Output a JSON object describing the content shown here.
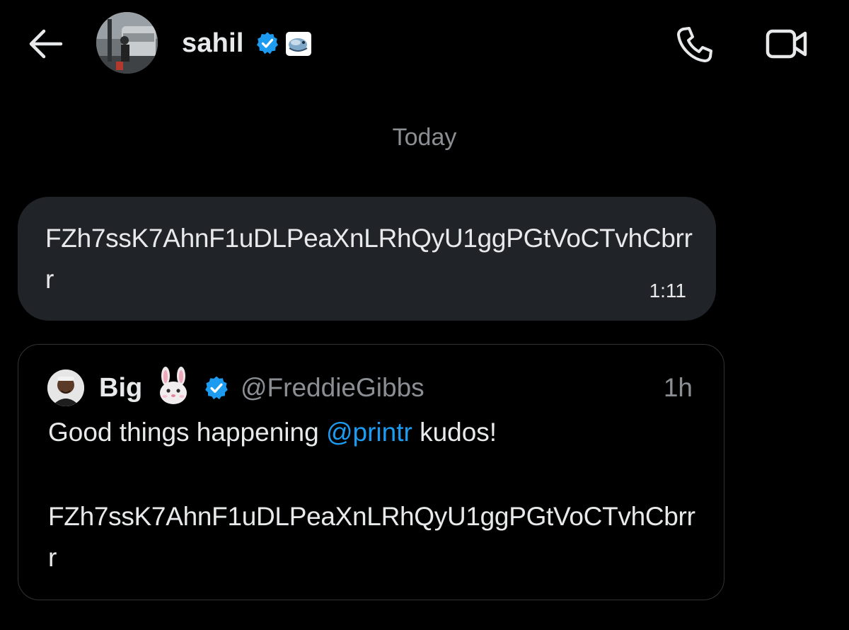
{
  "header": {
    "back_icon": "arrow-left-icon",
    "name": "sahil",
    "verified_icon": "verified-badge-icon",
    "affiliate_icon": "affiliate-badge-icon",
    "call_icon": "phone-icon",
    "video_icon": "video-camera-icon"
  },
  "conversation": {
    "date_separator": "Today",
    "message": {
      "text": "FZh7ssK7AhnF1uDLPeaXnLRhQyU1ggPGtVoCTvhCbrrr",
      "time": "1:11"
    },
    "quoted_tweet": {
      "display_name": "Big",
      "name_emoji": "🐰",
      "verified_icon": "verified-badge-icon",
      "handle": "@FreddieGibbs",
      "time": "1h",
      "text_before": "Good things happening ",
      "mention": "@printr",
      "text_after": " kudos!",
      "code": "FZh7ssK7AhnF1uDLPeaXnLRhQyU1ggPGtVoCTvhCbrrr"
    }
  },
  "colors": {
    "background": "#000000",
    "bubble": "#202327",
    "text": "#e7e9ea",
    "muted": "#8b8f94",
    "accent": "#1d9bf0",
    "border": "#2f3336"
  }
}
